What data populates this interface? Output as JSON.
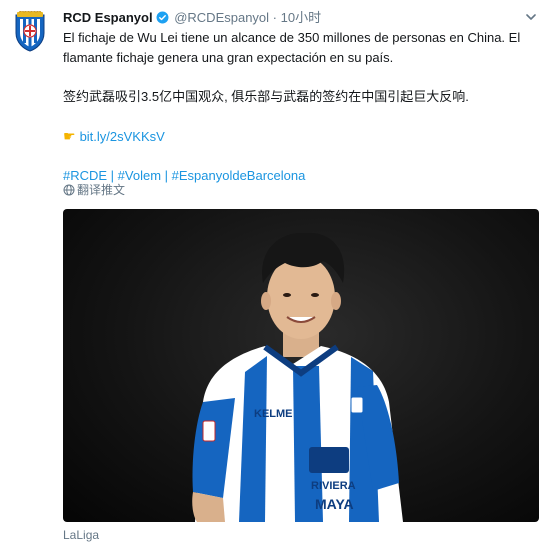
{
  "tweet": {
    "author_name": "RCD Espanyol",
    "handle": "@RCDEspanyol",
    "separator": "·",
    "time": "10小时",
    "text_es_line1": "El fichaje de Wu Lei tiene un alcance de 350 millones de personas en China. El",
    "text_es_line2": "flamante fichaje genera una gran expectación en su país.",
    "text_zh": "签约武磊吸引3.5亿中国观众, 俱乐部与武磊的签约在中国引起巨大反响.",
    "link": "bit.ly/2sVKKsV",
    "hashtags": "#RCDE | #Volem | #EspanyoldeBarcelona",
    "translate_label": "翻译推文",
    "photo_caption": "LaLiga",
    "shirt_sponsor": "KELME",
    "shirt_front_line1": "RIVIERA",
    "shirt_front_line2": "MAYA"
  },
  "colors": {
    "link": "#1b95e0",
    "verified": "#1da1f2",
    "muted": "#657786",
    "espanyol_blue": "#1565c0"
  },
  "icons": {
    "verified": "verified-badge-icon",
    "caret": "chevron-down-icon",
    "pointing_hand": "pointing-hand-icon",
    "globe": "globe-icon",
    "crest": "espanyol-crest-logo"
  }
}
